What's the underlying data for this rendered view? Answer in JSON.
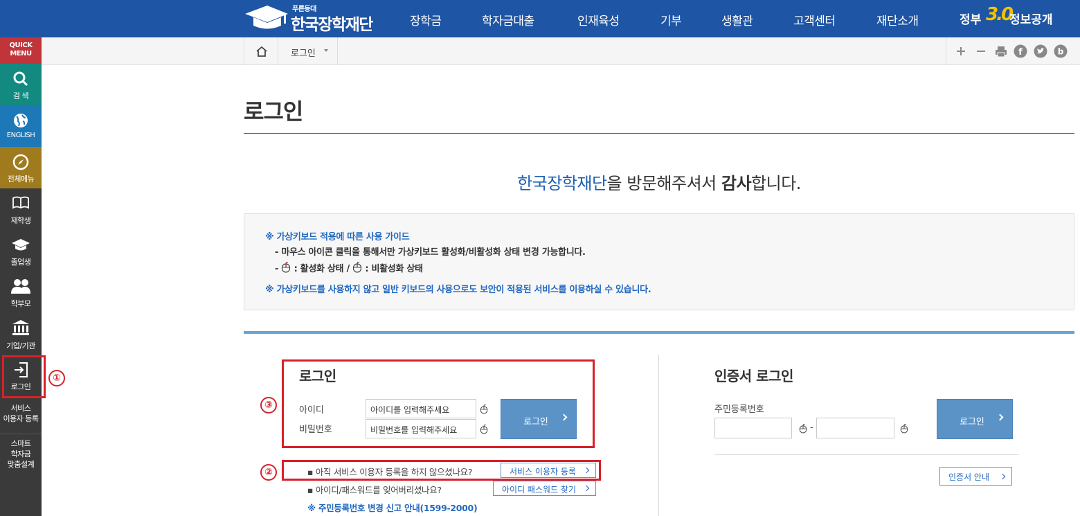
{
  "header": {
    "logo_small": "푸른등대",
    "logo_text": "한국장학재단",
    "nav": [
      "장학금",
      "학자금대출",
      "인재육성",
      "기부",
      "생활관",
      "고객센터",
      "재단소개"
    ],
    "gov_prefix": "정부",
    "gov_number": "3.0",
    "gov_suffix": "정보공개"
  },
  "quick_menu": {
    "title_line1": "QUICK",
    "title_line2": "MENU",
    "items": [
      {
        "label": "검 색",
        "icon": "search-icon",
        "color": "#138a80"
      },
      {
        "label": "ENGLISH",
        "icon": "globe-icon",
        "color": "#1d78b7"
      },
      {
        "label": "전체메뉴",
        "icon": "compass-icon",
        "color": "#9f7b1d"
      },
      {
        "label": "재학생",
        "icon": "book-icon",
        "color": "#3a3a3a"
      },
      {
        "label": "졸업생",
        "icon": "graduation-cap-icon",
        "color": "#3a3a3a"
      },
      {
        "label": "학부모",
        "icon": "people-icon",
        "color": "#3a3a3a"
      },
      {
        "label": "기업/기관",
        "icon": "institution-icon",
        "color": "#3a3a3a"
      },
      {
        "label": "로그인",
        "icon": "login-icon",
        "color": "#3a3a3a"
      }
    ],
    "service_line1": "서비스",
    "service_line2": "이용자 등록",
    "smart_line1": "스마트",
    "smart_line2": "학자금",
    "smart_line3": "맞춤설계"
  },
  "breadcrumb": {
    "current": "로그인"
  },
  "page": {
    "title": "로그인",
    "welcome_blue": "한국장학재단",
    "welcome_mid": "을 방문해주셔서 ",
    "welcome_bold": "감사",
    "welcome_end": "합니다."
  },
  "guide": {
    "line1": "※ 가상키보드 적용에 따른 사용 가이드",
    "line2": "- 마우스 아이콘 클릭을 통해서만 가상키보드 활성화/비활성화 상태 변경 가능합니다.",
    "line3_prefix": "- ",
    "line3_active": ": 활성화 상태 / ",
    "line3_inactive": ": 비활성화 상태",
    "line4": "※ 가상키보드를 사용하지 않고 일반 키보드의 사용으로도 보안이 적용된 서비스를 이용하실 수 있습니다."
  },
  "login": {
    "title": "로그인",
    "id_label": "아이디",
    "pw_label": "비밀번호",
    "id_placeholder": "아이디를 입력해주세요",
    "pw_placeholder": "비밀번호를 입력해주세요",
    "button": "로그인",
    "q1": "▪ 아직 서비스 이용자 등록을 하지 않으셨나요?",
    "q1_button": "서비스 이용자 등록",
    "q2": "▪ 아이디/패스워드를 잊어버리셨나요?",
    "q2_button": "아이디 패스워드 찾기",
    "notice": "※ 주민등록번호 변경 신고 안내(1599-2000)"
  },
  "cert": {
    "title": "인증서 로그인",
    "rrn_label": "주민등록번호",
    "dash": "-",
    "button": "로그인",
    "guide_button": "인증서 안내"
  },
  "annotations": {
    "m1": "①",
    "m2": "②",
    "m3": "③"
  },
  "colors": {
    "header": "#1e55a5",
    "quick_bg": "#3a3a3a",
    "quick_title": "#c0343a",
    "accent_blue": "#1e60b0",
    "highlight_red": "#d7202a"
  }
}
